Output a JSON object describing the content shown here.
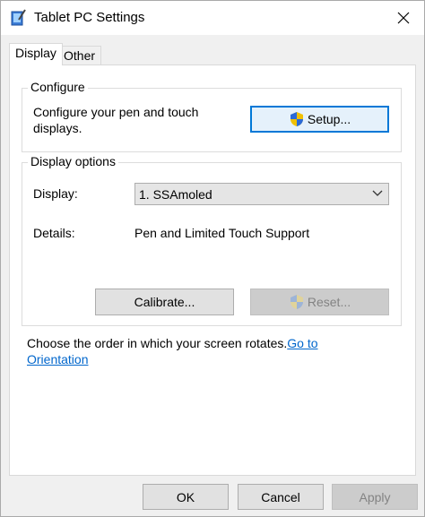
{
  "window": {
    "title": "Tablet PC Settings"
  },
  "tabs": [
    {
      "label": "Display",
      "selected": true
    },
    {
      "label": "Other",
      "selected": false
    }
  ],
  "configure": {
    "legend": "Configure",
    "description_line1": "Configure your pen and touch",
    "description_line2": "displays.",
    "setup_label": "Setup..."
  },
  "display_options": {
    "legend": "Display options",
    "display_label": "Display:",
    "display_value": "1. SSAmoled",
    "details_label": "Details:",
    "details_value": "Pen and Limited Touch Support",
    "calibrate_label": "Calibrate...",
    "reset_label": "Reset..."
  },
  "orientation": {
    "text": "Choose the order in which your screen rotates.",
    "link_part1": "Go to",
    "link_part2": "Orientation"
  },
  "footer": {
    "ok_label": "OK",
    "cancel_label": "Cancel",
    "apply_label": "Apply"
  },
  "colors": {
    "accent": "#0078d7",
    "link": "#0066cc",
    "disabled_text": "#838383"
  }
}
